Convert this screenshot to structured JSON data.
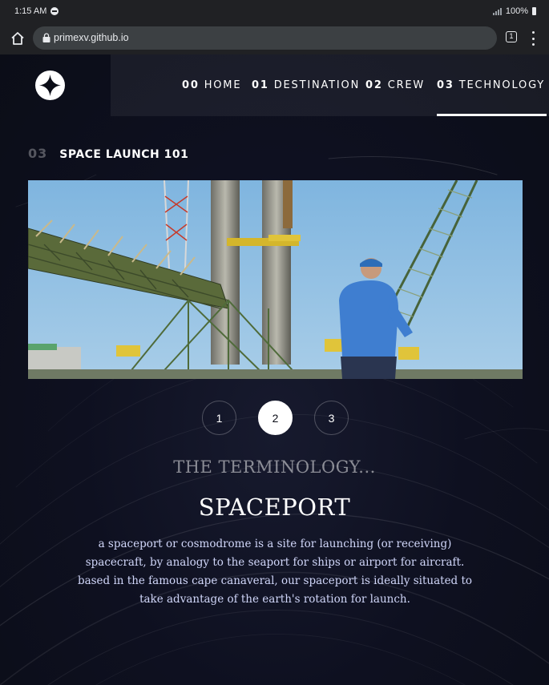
{
  "status_bar": {
    "time": "1:15 AM",
    "battery": "100%"
  },
  "browser": {
    "url": "primexv.github.io",
    "tab_count": "1"
  },
  "nav": {
    "items": [
      {
        "num": "00",
        "label": "HOME"
      },
      {
        "num": "01",
        "label": "DESTINATION"
      },
      {
        "num": "02",
        "label": "CREW"
      },
      {
        "num": "03",
        "label": "TECHNOLOGY"
      }
    ],
    "active": "TECHNOLOGY"
  },
  "section": {
    "number": "03",
    "title": "SPACE LAUNCH 101"
  },
  "pager": {
    "buttons": [
      "1",
      "2",
      "3"
    ],
    "active": "2"
  },
  "content": {
    "eyebrow": "THE TERMINOLOGY...",
    "name": "SPACEPORT",
    "description": "a spaceport or cosmodrome is a site for launching (or receiving) spacecraft, by analogy to the seaport for ships or airport for aircraft. based in the famous cape canaveral, our spaceport is ideally situated to take advantage of the earth's rotation for launch."
  },
  "colors": {
    "page_bg": "#0b0d17",
    "text_light": "#d0d6f9",
    "accent": "#ffffff"
  }
}
